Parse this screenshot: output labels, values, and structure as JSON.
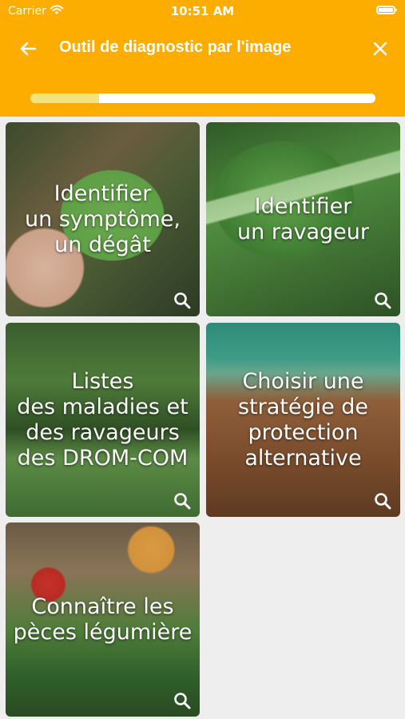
{
  "status_bar": {
    "carrier": "Carrier",
    "time": "10:51 AM"
  },
  "header": {
    "title": "Outil de diagnostic par l'image",
    "back_icon": "arrow-left-icon",
    "close_icon": "close-icon",
    "progress": 0.2,
    "colors": {
      "accent": "#fdac00",
      "progress_fill": "#f5e27a"
    }
  },
  "tiles": [
    {
      "label": "Identifier\nun symptôme,\nun dégât",
      "icon": "search-icon"
    },
    {
      "label": "Identifier\nun ravageur",
      "icon": "search-icon"
    },
    {
      "label": "Listes\ndes maladies et\ndes ravageurs\ndes DROM-COM",
      "icon": "search-icon"
    },
    {
      "label": "Choisir une\nstratégie de\nprotection\nalternative",
      "icon": "search-icon"
    },
    {
      "label": "Connaître les\npèces légumière",
      "icon": "search-icon"
    }
  ]
}
